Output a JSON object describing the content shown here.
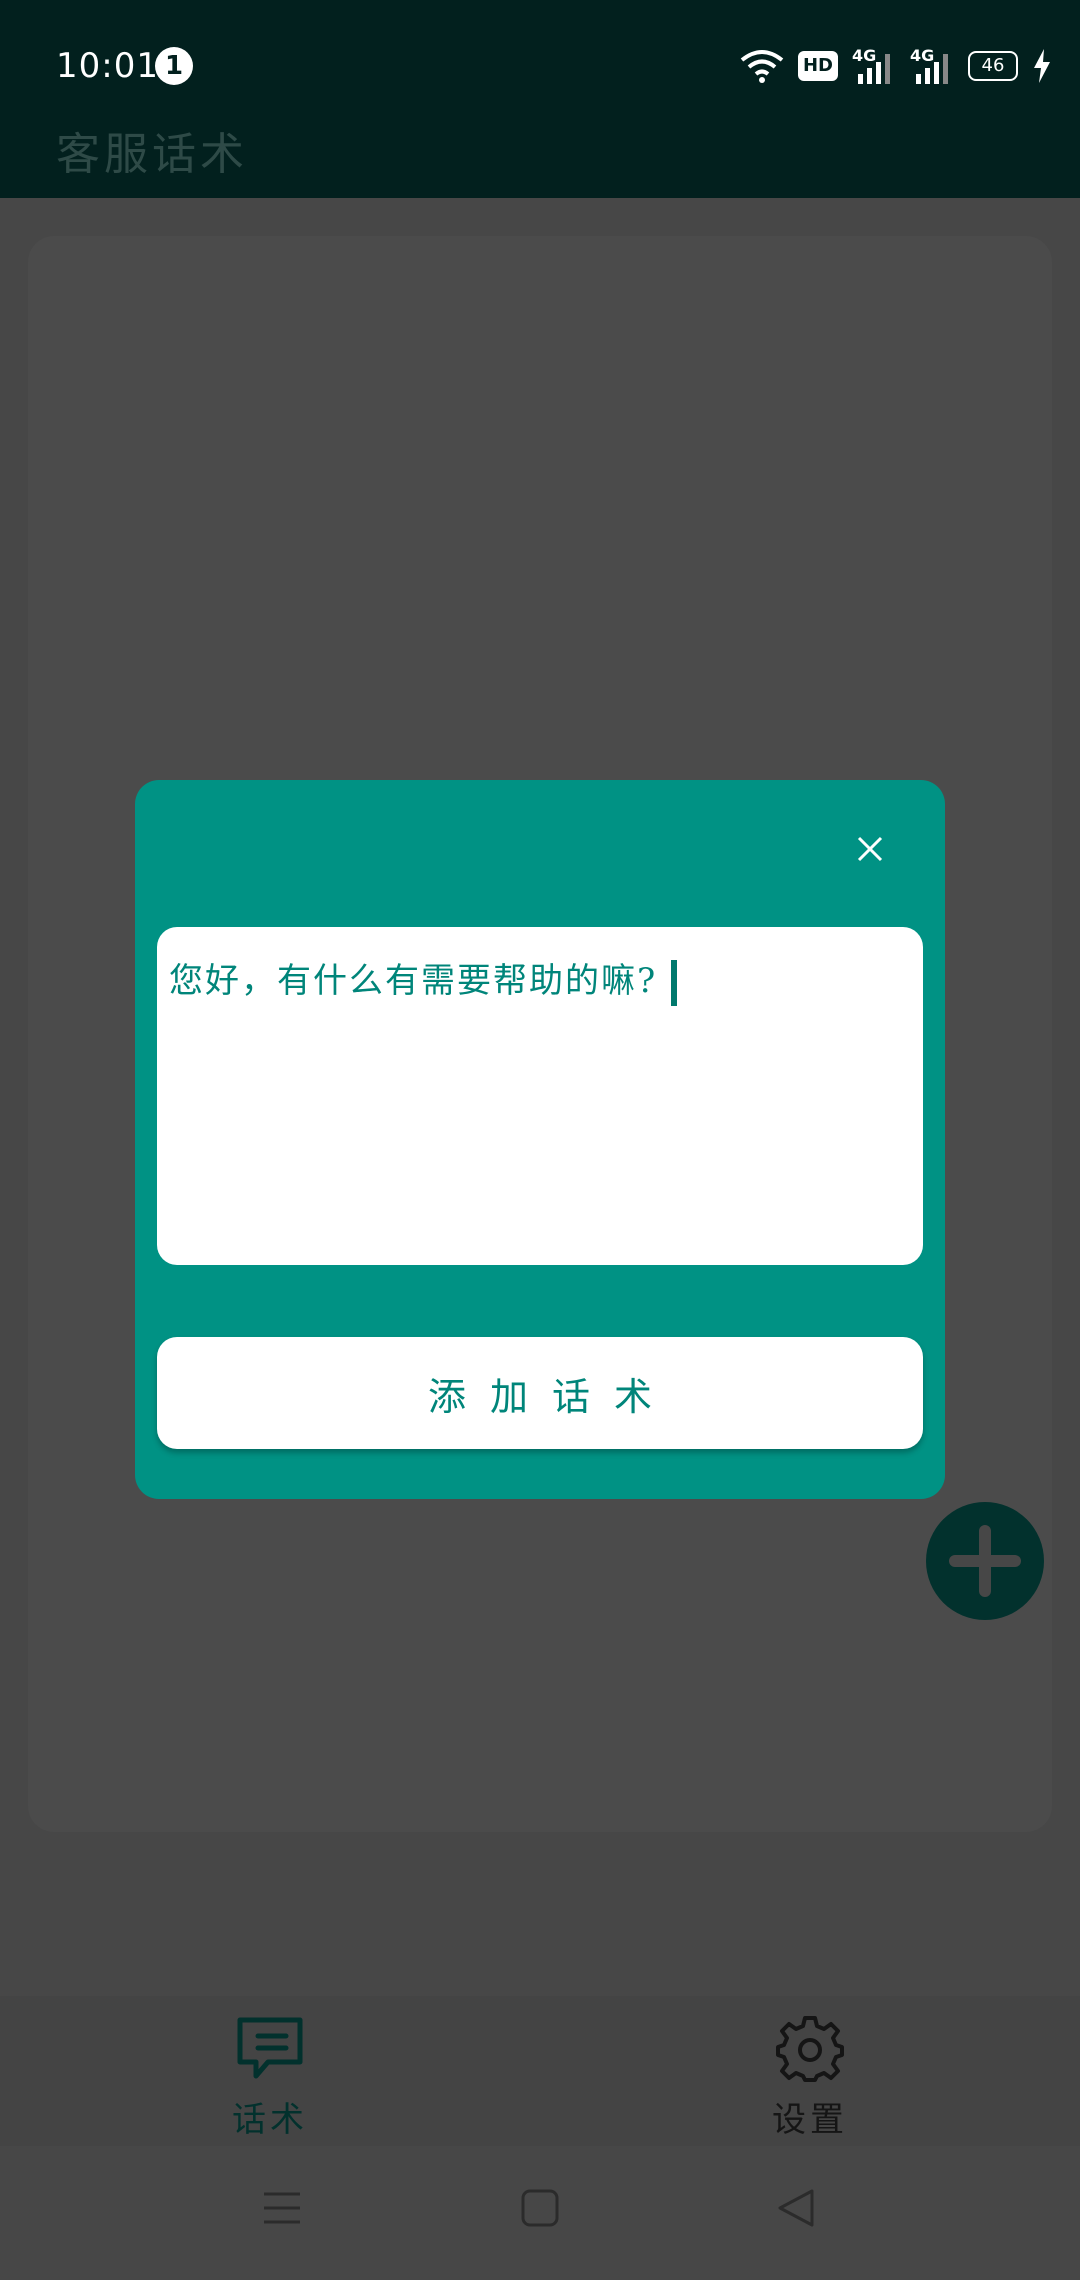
{
  "status_bar": {
    "time": "10:01",
    "notification_count": "1",
    "hd_label": "HD",
    "network_1": "4G",
    "network_2": "4G",
    "battery": "46"
  },
  "header": {
    "title": "客服话术"
  },
  "dialog": {
    "input_value": "您好，有什么有需要帮助的嘛?",
    "add_button_label": "添加话术"
  },
  "bottom_nav": {
    "items": [
      {
        "label": "话术",
        "icon": "chat-icon",
        "active": true
      },
      {
        "label": "设置",
        "icon": "gear-icon",
        "active": false
      }
    ]
  },
  "colors": {
    "dialog_bg": "#009284",
    "accent_text": "#00857a",
    "header_bg": "#02201e",
    "overlay_bg": "#474747"
  }
}
